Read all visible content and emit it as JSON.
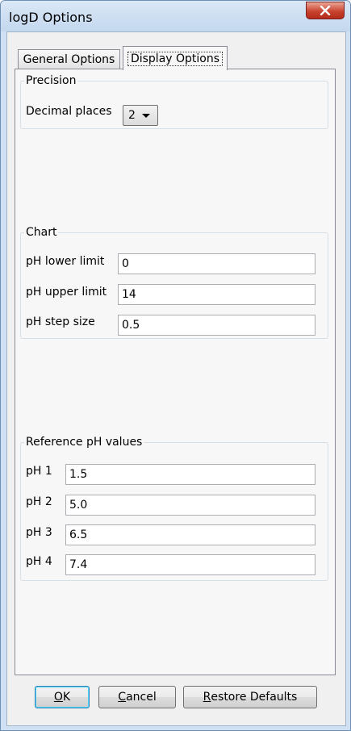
{
  "window": {
    "title": "logD Options"
  },
  "tabs": [
    {
      "label": "General Options",
      "selected": false
    },
    {
      "label": "Display Options",
      "selected": true
    }
  ],
  "precision": {
    "legend": "Precision",
    "decimal_label": "Decimal places",
    "decimal_value": "2"
  },
  "chart": {
    "legend": "Chart",
    "lower_label": "pH lower limit",
    "lower_value": "0",
    "upper_label": "pH upper limit",
    "upper_value": "14",
    "step_label": "pH step size",
    "step_value": "0.5"
  },
  "reference": {
    "legend": "Reference pH values",
    "items": [
      {
        "label": "pH 1",
        "value": "1.5"
      },
      {
        "label": "pH 2",
        "value": "5.0"
      },
      {
        "label": "pH 3",
        "value": "6.5"
      },
      {
        "label": "pH 4",
        "value": "7.4"
      }
    ]
  },
  "buttons": {
    "ok": {
      "accel": "O",
      "rest": "K"
    },
    "cancel": {
      "accel": "C",
      "rest": "ancel"
    },
    "restore": {
      "accel": "R",
      "rest": "estore Defaults"
    }
  }
}
